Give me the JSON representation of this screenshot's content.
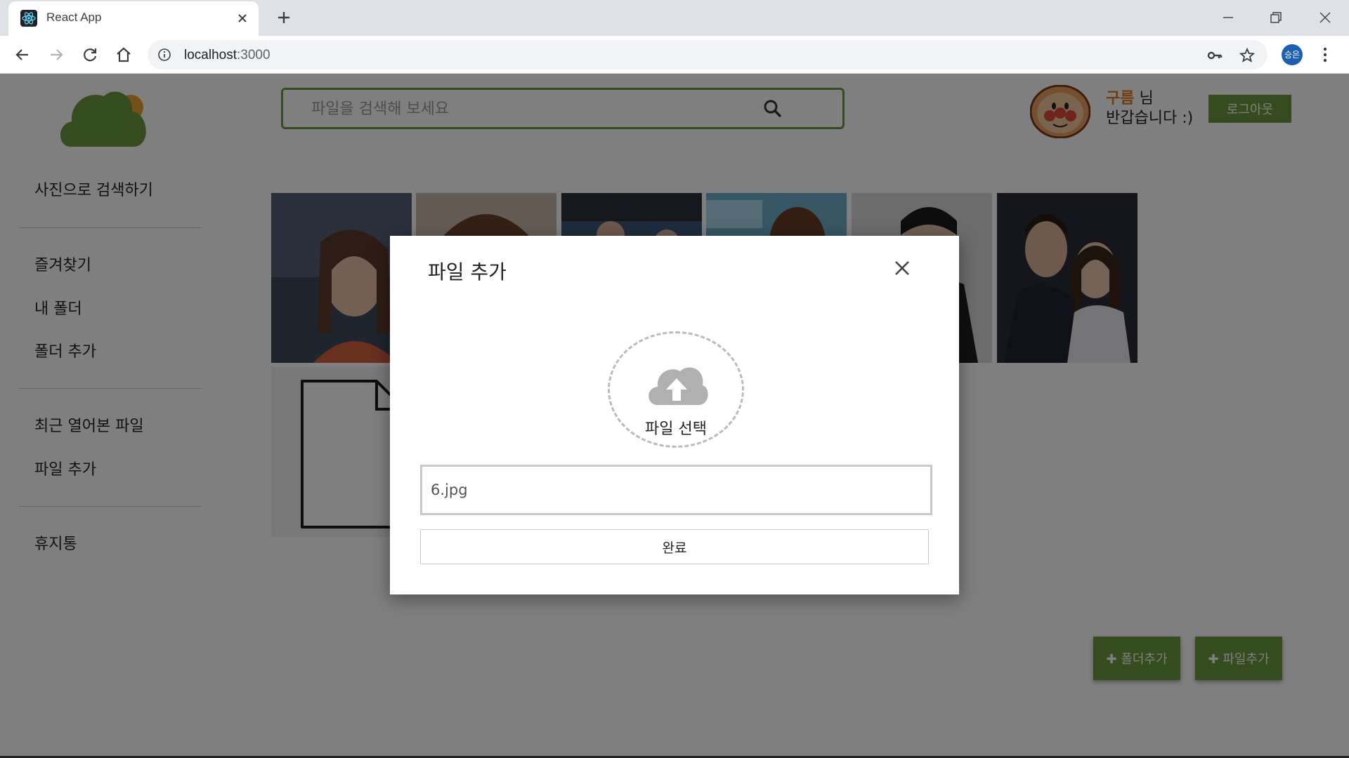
{
  "browser": {
    "tab_title": "React App",
    "url_host": "localhost",
    "url_port": ":3000",
    "profile_initials": "승은"
  },
  "header": {
    "search_placeholder": "파일을 검색해 보세요",
    "username": "구름",
    "greeting_suffix": " 님",
    "greeting_line2": "반갑습니다 :)",
    "logout_label": "로그아웃"
  },
  "sidebar": {
    "items": [
      {
        "label": "사진으로 검색하기"
      },
      {
        "label": "즐겨찾기"
      },
      {
        "label": "내 폴더"
      },
      {
        "label": "폴더 추가"
      },
      {
        "label": "최근 열어본 파일"
      },
      {
        "label": "파일 추가"
      },
      {
        "label": "휴지통"
      }
    ]
  },
  "actions": {
    "add_folder_label": "✚ 폴더추가",
    "add_file_label": "✚ 파일추가"
  },
  "modal": {
    "title": "파일 추가",
    "upload_label": "파일 선택",
    "filename_value": "6.jpg",
    "confirm_label": "완료"
  },
  "colors": {
    "brand_green": "#6a9b3d",
    "username_orange": "#e07a1e"
  }
}
